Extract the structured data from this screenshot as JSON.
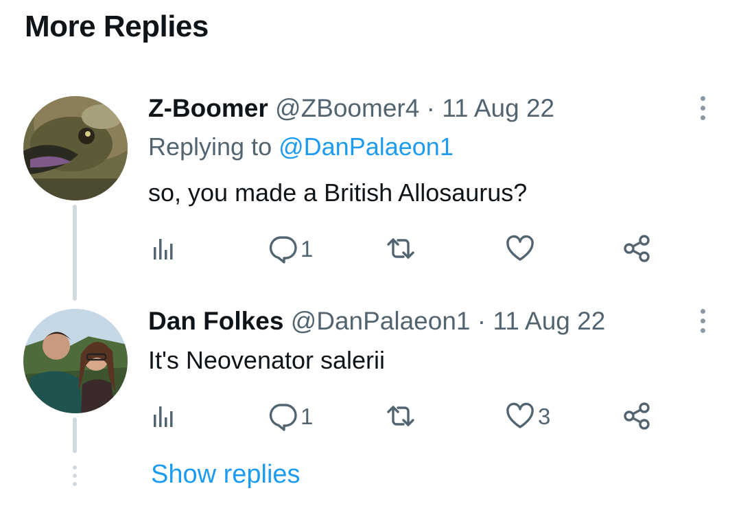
{
  "section": {
    "title": "More Replies"
  },
  "tweets": [
    {
      "display_name": "Z-Boomer",
      "handle": "@ZBoomer4",
      "separator": "·",
      "date": "11 Aug 22",
      "replying_prefix": "Replying to ",
      "replying_to": "@DanPalaeon1",
      "text": "so, you made a British Allosaurus?",
      "replies": "1",
      "retweets": "",
      "likes": "",
      "avatar_icon": "lizard-avatar"
    },
    {
      "display_name": "Dan Folkes",
      "handle": "@DanPalaeon1",
      "separator": "·",
      "date": "11 Aug 22",
      "text": "It's Neovenator salerii",
      "replies": "1",
      "retweets": "",
      "likes": "3",
      "avatar_icon": "couple-selfie-avatar"
    }
  ],
  "show_replies_label": "Show replies",
  "icons": [
    "analytics-icon",
    "reply-icon",
    "retweet-icon",
    "like-icon",
    "share-icon",
    "more-icon"
  ],
  "colors": {
    "accent": "#1d9bf0",
    "text": "#0f1419",
    "secondary": "#536471",
    "thread_line": "#cfd9de"
  }
}
